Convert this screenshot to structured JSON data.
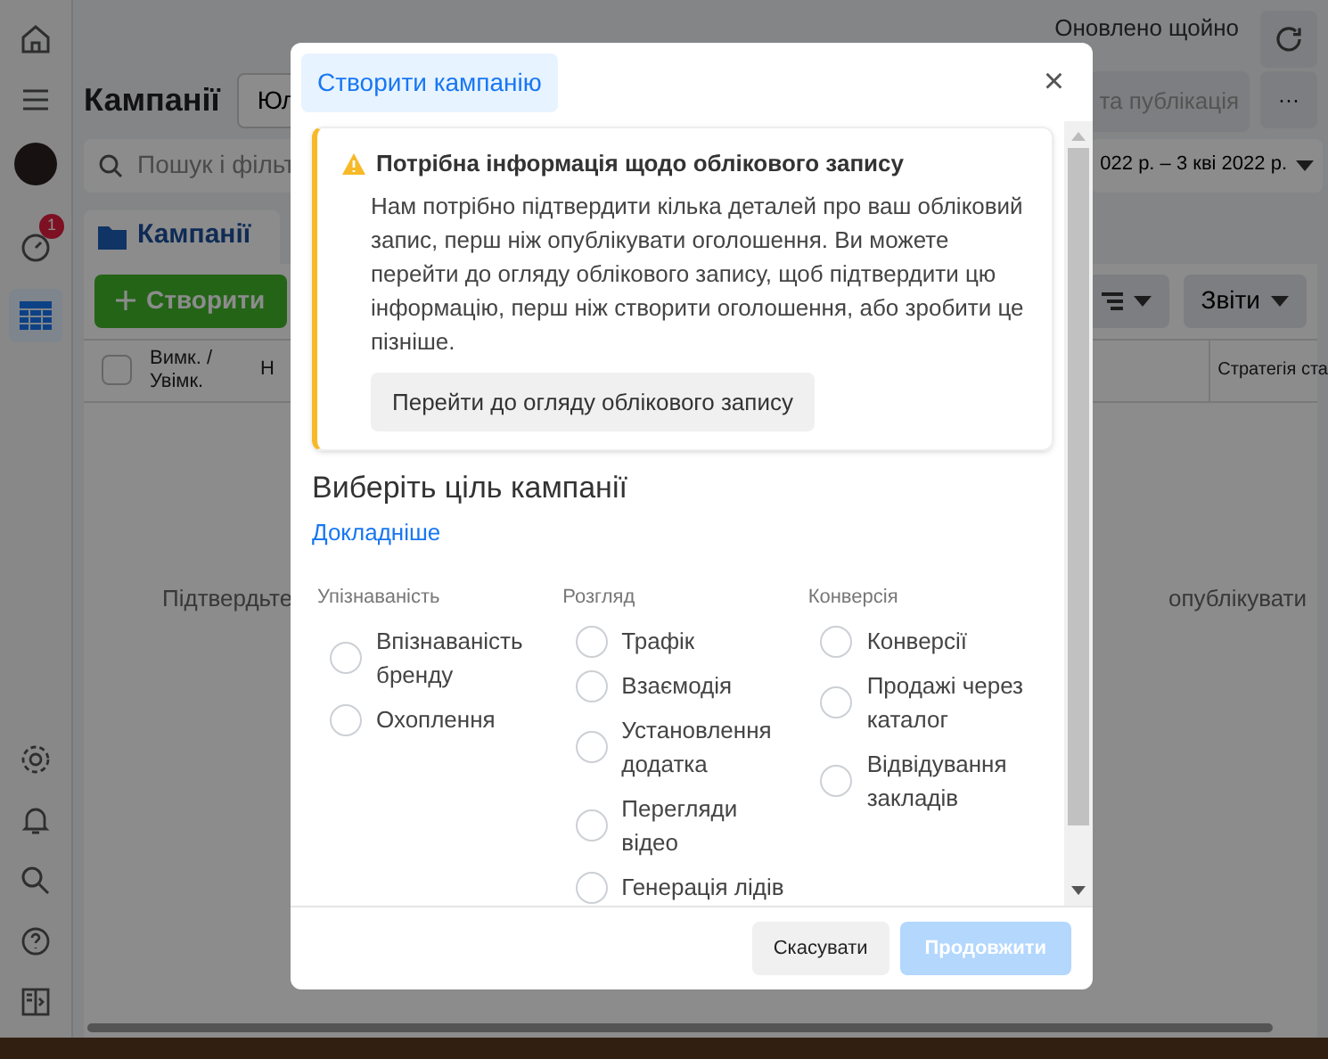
{
  "page": {
    "title": "Кампанії",
    "account_dropdown": "Юл",
    "updated": "Оновлено щойно",
    "publish_button": "та публікація",
    "more_button": "···",
    "search": {
      "placeholder": "Пошук і фільт"
    },
    "date_range": "022 р. – 3 кві 2022 р.",
    "notification_badge": "1",
    "tab": "Кампанії",
    "create_button": "Створити",
    "reports_button": "Звіти",
    "select_all": {
      "checked": false
    },
    "columns": [
      "Вимк. / Увімк.",
      "Н",
      "Стратегія ста"
    ],
    "empty_text_left": "Підтвердьте",
    "empty_text_right": "опублікувати"
  },
  "dialog": {
    "tab": "Створити кампанію",
    "close": "×",
    "alert": {
      "title": "Потрібна інформація щодо облікового запису",
      "body": "Нам потрібно підтвердити кілька деталей про ваш обліковий запис, перш ніж опублікувати оголошення. Ви можете перейти до огляду облікового запису, щоб підтвердити цю інформацію, перш ніж створити оголошення, або зробити це пізніше.",
      "button": "Перейти до огляду облікового запису"
    },
    "heading": "Виберіть ціль кампанії",
    "learn_more": "Докладніше",
    "groups": [
      {
        "title": "Упізнаваність",
        "options": [
          {
            "label": "Впізнаваність бренду",
            "selected": false
          },
          {
            "label": "Охоплення",
            "selected": false
          }
        ]
      },
      {
        "title": "Розгляд",
        "options": [
          {
            "label": "Трафік",
            "selected": false
          },
          {
            "label": "Взаємодія",
            "selected": false
          },
          {
            "label": "Установлення додатка",
            "selected": false
          },
          {
            "label": "Перегляди відео",
            "selected": false
          },
          {
            "label": "Генерація лідів",
            "selected": false
          }
        ]
      },
      {
        "title": "Конверсія",
        "options": [
          {
            "label": "Конверсії",
            "selected": false
          },
          {
            "label": "Продажі через каталог",
            "selected": false
          },
          {
            "label": "Відвідування закладів",
            "selected": false
          }
        ]
      }
    ],
    "cancel": "Скасувати",
    "continue": {
      "label": "Продовжити",
      "disabled": true
    }
  }
}
